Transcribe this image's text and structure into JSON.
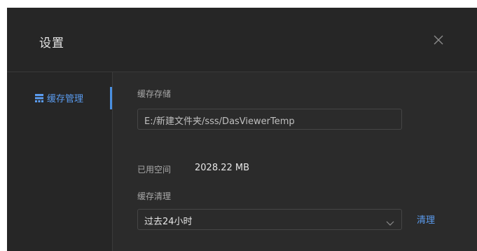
{
  "dialog": {
    "title": "设置",
    "close_icon": "close-icon"
  },
  "sidebar": {
    "items": [
      {
        "label": "缓存管理",
        "icon": "storage-icon",
        "active": true
      }
    ]
  },
  "cache": {
    "storage_label": "缓存存储",
    "path_value": "E:/新建文件夹/sss/DasViewerTemp",
    "used_label": "已用空间",
    "used_value": "2028.22 MB",
    "cleanup_label": "缓存清理",
    "cleanup_selected": "过去24小时",
    "clear_button": "清理"
  },
  "colors": {
    "background": "#262626",
    "content_background": "#2b2b2b",
    "accent": "#5b9cf0",
    "border": "#464646"
  }
}
